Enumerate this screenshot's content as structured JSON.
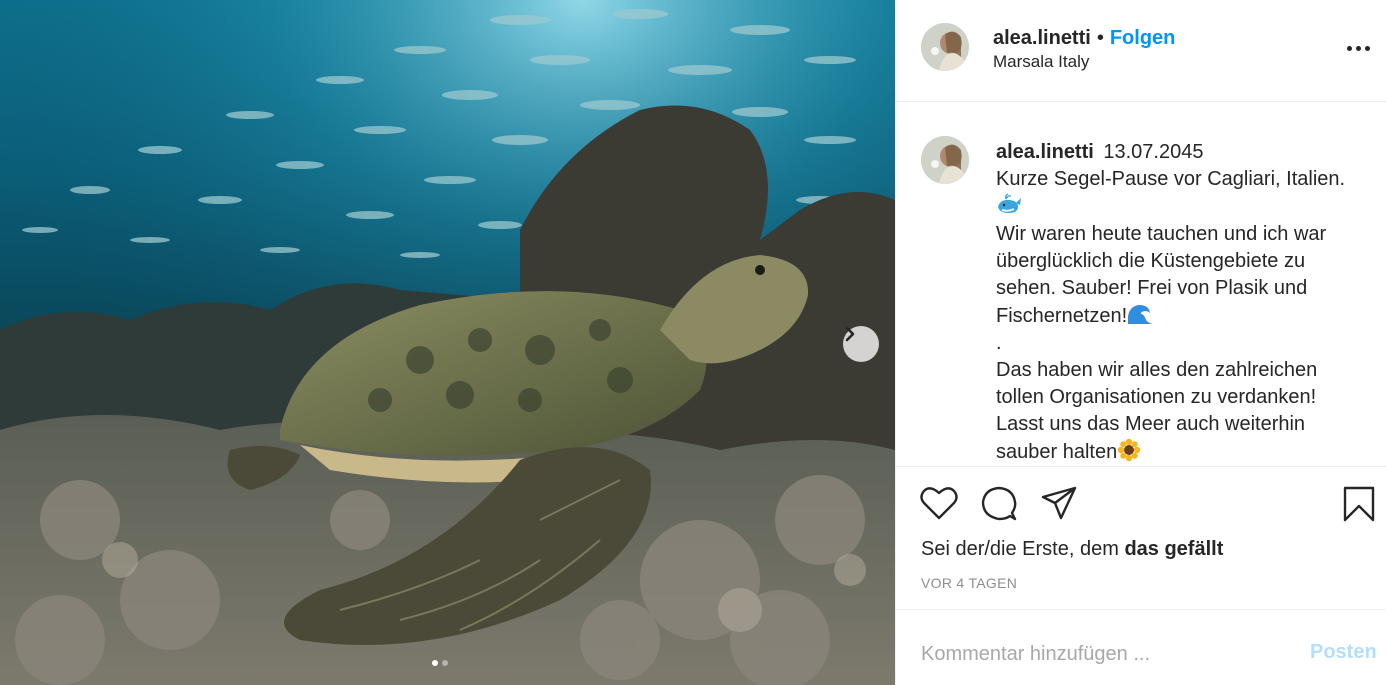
{
  "post": {
    "image_alt": "Sea turtle resting on a coral reef beneath a school of fish",
    "carousel": {
      "total": 2,
      "current": 1,
      "next_icon": "chevron-right-icon"
    }
  },
  "header": {
    "username": "alea.linetti",
    "separator": "•",
    "follow_label": "Folgen",
    "location": "Marsala Italy",
    "more_icon": "more-horizontal-icon"
  },
  "caption": {
    "username": "alea.linetti",
    "date": "13.07.2045",
    "line1": "Kurze Segel-Pause vor Cagliari, Italien.",
    "line2": "Wir waren heute tauchen und ich war überglücklich die Küstengebiete zu sehen. Sauber! Frei von Plasik und Fischernetzen!",
    "line3": ".",
    "line4": "Das haben wir alles den zahlreichen tollen Organisationen zu verdanken! Lasst uns das Meer auch weiterhin sauber halten",
    "emojis": [
      "whale-emoji",
      "wave-emoji",
      "sunflower-emoji"
    ]
  },
  "actions": {
    "icons": [
      "heart-icon",
      "comment-icon",
      "share-icon",
      "bookmark-icon"
    ],
    "likes_prefix": "Sei der/die Erste, dem ",
    "likes_bold": "das gefällt",
    "time_ago": "VOR 4 TAGEN"
  },
  "comment_box": {
    "placeholder": "Kommentar hinzufügen ...",
    "post_label": "Posten"
  },
  "colors": {
    "accent": "#0095f6",
    "post_disabled": "#b2dffc",
    "muted": "#8e8e8e",
    "divider": "#efefef"
  }
}
